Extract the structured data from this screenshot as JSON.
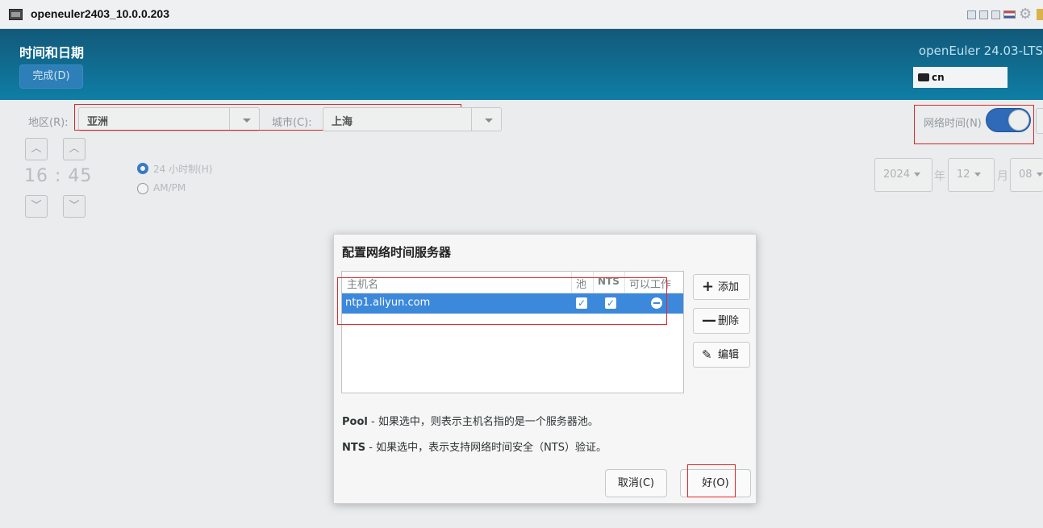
{
  "window": {
    "title": "openeuler2403_10.0.0.203"
  },
  "header": {
    "spoke_title": "时间和日期",
    "done_label": "完成(D)",
    "product": "openEuler 24.03-LTS",
    "keyboard": "cn"
  },
  "spoke": {
    "region_label": "地区(R):",
    "region_value": "亚洲",
    "city_label": "城市(C):",
    "city_value": "上海",
    "network_time_label": "网络时间(N)",
    "network_time_on": true,
    "time": "16 : 45",
    "format_24h": "24 小时制(H)",
    "format_ampm": "AM/PM",
    "year": "2024",
    "year_unit": "年",
    "month": "12",
    "month_unit": "月",
    "day": "08"
  },
  "dialog": {
    "title": "配置网络时间服务器",
    "columns": {
      "host": "主机名",
      "pool": "池",
      "nts": "NTS",
      "working": "可以工作"
    },
    "servers": [
      {
        "host": "ntp1.aliyun.com",
        "pool": true,
        "nts": true,
        "working": "stopped"
      }
    ],
    "add_label": "添加",
    "remove_label": "删除",
    "edit_label": "编辑",
    "pool_note_term": "Pool",
    "pool_note_text": " - 如果选中，则表示主机名指的是一个服务器池。",
    "nts_note_term": "NTS",
    "nts_note_text": " - 如果选中，表示支持网络时间安全（NTS）验证。",
    "cancel_label": "取消(C)",
    "ok_label": "好(O)"
  },
  "colors": {
    "header_bg": "#0f7ea5",
    "selection": "#3c88db",
    "toggle_on": "#2f6ec0",
    "highlight": "#e4282b"
  }
}
